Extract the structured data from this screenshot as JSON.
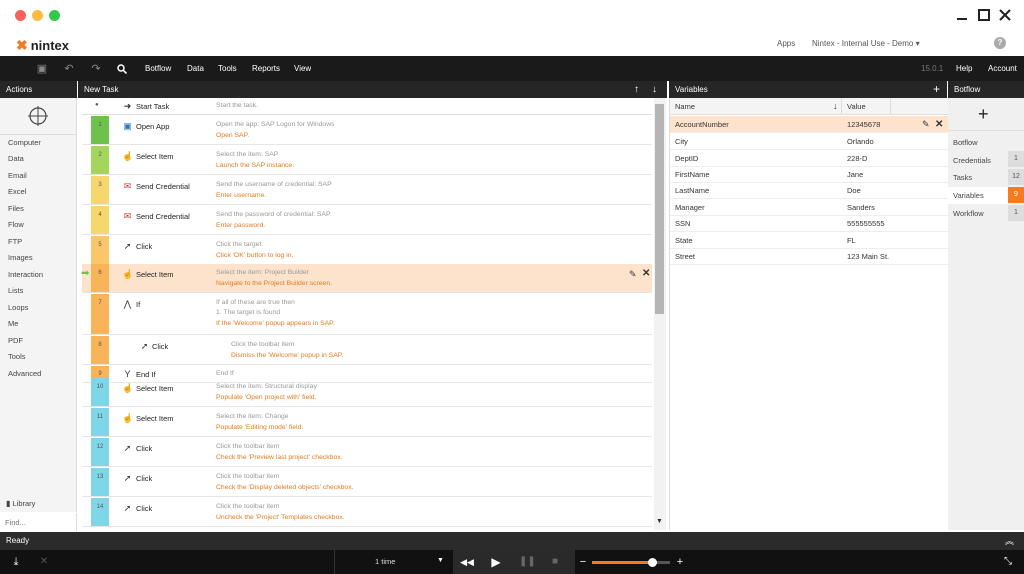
{
  "brand": {
    "logo_text": "nintex",
    "apps_label": "Apps",
    "account_label": "Nintex - Internal Use - Demo ▾",
    "help_icon": "help-icon"
  },
  "menubar": {
    "items": [
      "Botflow",
      "Data",
      "Tools",
      "Reports",
      "View"
    ],
    "version": "15.0.1",
    "help_label": "Help",
    "account_label": "Account"
  },
  "actions_panel": {
    "header": "Actions",
    "items": [
      "Computer",
      "Data",
      "Email",
      "Excel",
      "Files",
      "Flow",
      "FTP",
      "Images",
      "Interaction",
      "Lists",
      "Loops",
      "Me",
      "PDF",
      "Tools",
      "Advanced"
    ],
    "library_label": "Library",
    "find_placeholder": "Find..."
  },
  "task_panel": {
    "header": "New Task",
    "start": {
      "num": "●",
      "name": "Start Task",
      "desc": "Start the task."
    },
    "rows": [
      {
        "num": "1",
        "name": "Open App",
        "desc": "Open the app: SAP Logon for Windows",
        "note": "Open SAP.",
        "color": "#6cc24a",
        "icon": "open-app-icon"
      },
      {
        "num": "2",
        "name": "Select Item",
        "desc": "Select the item: SAP",
        "note": "Launch the SAP instance.",
        "color": "#a4d65e",
        "icon": "select-item-icon"
      },
      {
        "num": "3",
        "name": "Send Credential",
        "desc": "Send the username of credential: SAP",
        "note": "Enter username.",
        "color": "#f5d76e",
        "icon": "send-credential-icon"
      },
      {
        "num": "4",
        "name": "Send Credential",
        "desc": "Send the password of credential: SAP",
        "note": "Enter password.",
        "color": "#f5d76e",
        "icon": "send-credential-icon"
      },
      {
        "num": "5",
        "name": "Click",
        "desc": "Click the target.",
        "note": "Click 'OK' button to log in.",
        "color": "#fbc66a",
        "icon": "click-icon"
      },
      {
        "num": "6",
        "name": "Select Item",
        "desc": "Select the item: Project Builder",
        "note": "Navigate to the Project Builder screen.",
        "color": "#f9b45a",
        "icon": "select-item-icon"
      },
      {
        "num": "7",
        "name": "If",
        "desc": "If all of these are true then",
        "desc2": "1. The target is found",
        "note": "If the 'Welcome' popup appears in SAP.",
        "color": "#f9b45a",
        "icon": "if-icon"
      },
      {
        "num": "8",
        "name": "Click",
        "desc": "Click the toolbar item",
        "note": "Dismiss the 'Welcome' popup in SAP.",
        "color": "#f9b45a",
        "icon": "click-icon"
      },
      {
        "num": "9",
        "name": "End If",
        "desc": "End If",
        "note": "",
        "color": "#f9b45a",
        "icon": "end-if-icon"
      },
      {
        "num": "10",
        "name": "Select Item",
        "desc": "Select the item: Structural display",
        "note": "Populate 'Open project with' field.",
        "color": "#7fd6e6",
        "icon": "select-item-icon"
      },
      {
        "num": "11",
        "name": "Select Item",
        "desc": "Select the item: Change",
        "note": "Populate 'Editing mode' field.",
        "color": "#7fd6e6",
        "icon": "select-item-icon"
      },
      {
        "num": "12",
        "name": "Click",
        "desc": "Click the toolbar item",
        "note": "Check the 'Preview last project' checkbox.",
        "color": "#7fd6e6",
        "icon": "click-icon"
      },
      {
        "num": "13",
        "name": "Click",
        "desc": "Click the toolbar item",
        "note": "Check the 'Display deleted objects' checkbox.",
        "color": "#7fd6e6",
        "icon": "click-icon"
      },
      {
        "num": "14",
        "name": "Click",
        "desc": "Click the toolbar item",
        "note": "Uncheck the 'Project' Templates checkbox.",
        "color": "#7fd6e6",
        "icon": "click-icon"
      }
    ]
  },
  "variables_panel": {
    "header": "Variables",
    "col_name": "Name",
    "col_value": "Value",
    "rows": [
      {
        "name": "AccountNumber",
        "value": "12345678"
      },
      {
        "name": "City",
        "value": "Orlando"
      },
      {
        "name": "DeptID",
        "value": "228-D"
      },
      {
        "name": "FirstName",
        "value": "Jane"
      },
      {
        "name": "LastName",
        "value": "Doe"
      },
      {
        "name": "Manager",
        "value": "Sanders"
      },
      {
        "name": "SSN",
        "value": "555555555"
      },
      {
        "name": "State",
        "value": "FL"
      },
      {
        "name": "Street",
        "value": "123 Main St."
      }
    ]
  },
  "botflow_panel": {
    "header": "Botflow",
    "items": [
      {
        "label": "Botflow",
        "count": ""
      },
      {
        "label": "Credentials",
        "count": "1"
      },
      {
        "label": "Tasks",
        "count": "12"
      },
      {
        "label": "Variables",
        "count": "9"
      },
      {
        "label": "Workflow",
        "count": "1"
      }
    ]
  },
  "status": {
    "text": "Ready"
  },
  "player": {
    "repeat_label": "1 time"
  },
  "colors": {
    "accent": "#f47b20",
    "highlight": "#fde3cc"
  }
}
